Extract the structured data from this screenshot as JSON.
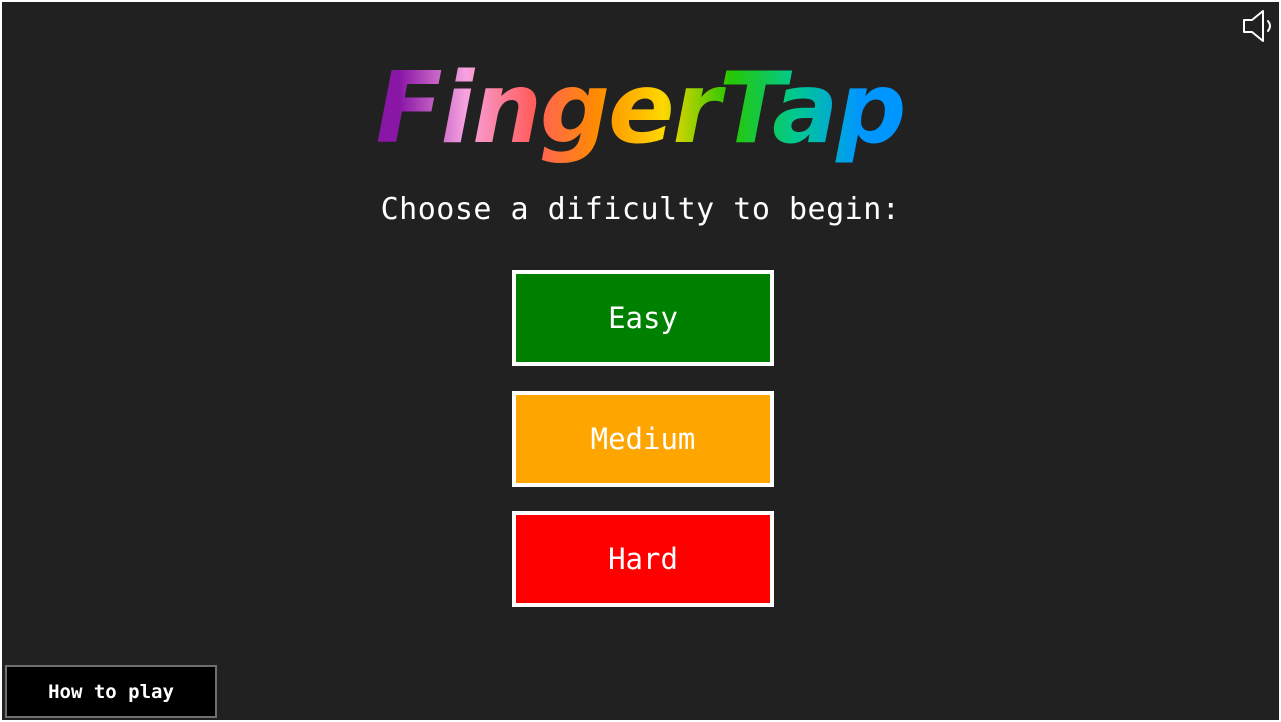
{
  "title": {
    "text": "FingerTap",
    "gradient_colors": [
      "#8a16a6",
      "#f7a3e0",
      "#ff5e5e",
      "#ff8c00",
      "#ffd700",
      "#28c800",
      "#00c98e",
      "#0096ff"
    ]
  },
  "subtitle": "Choose a dificulty to begin:",
  "difficulty": {
    "easy": {
      "label": "Easy",
      "color": "#008000"
    },
    "medium": {
      "label": "Medium",
      "color": "#ffa500"
    },
    "hard": {
      "label": "Hard",
      "color": "#ff0000"
    }
  },
  "sound": {
    "icon": "speaker-icon"
  },
  "how_to_play": {
    "label": "How to play"
  }
}
